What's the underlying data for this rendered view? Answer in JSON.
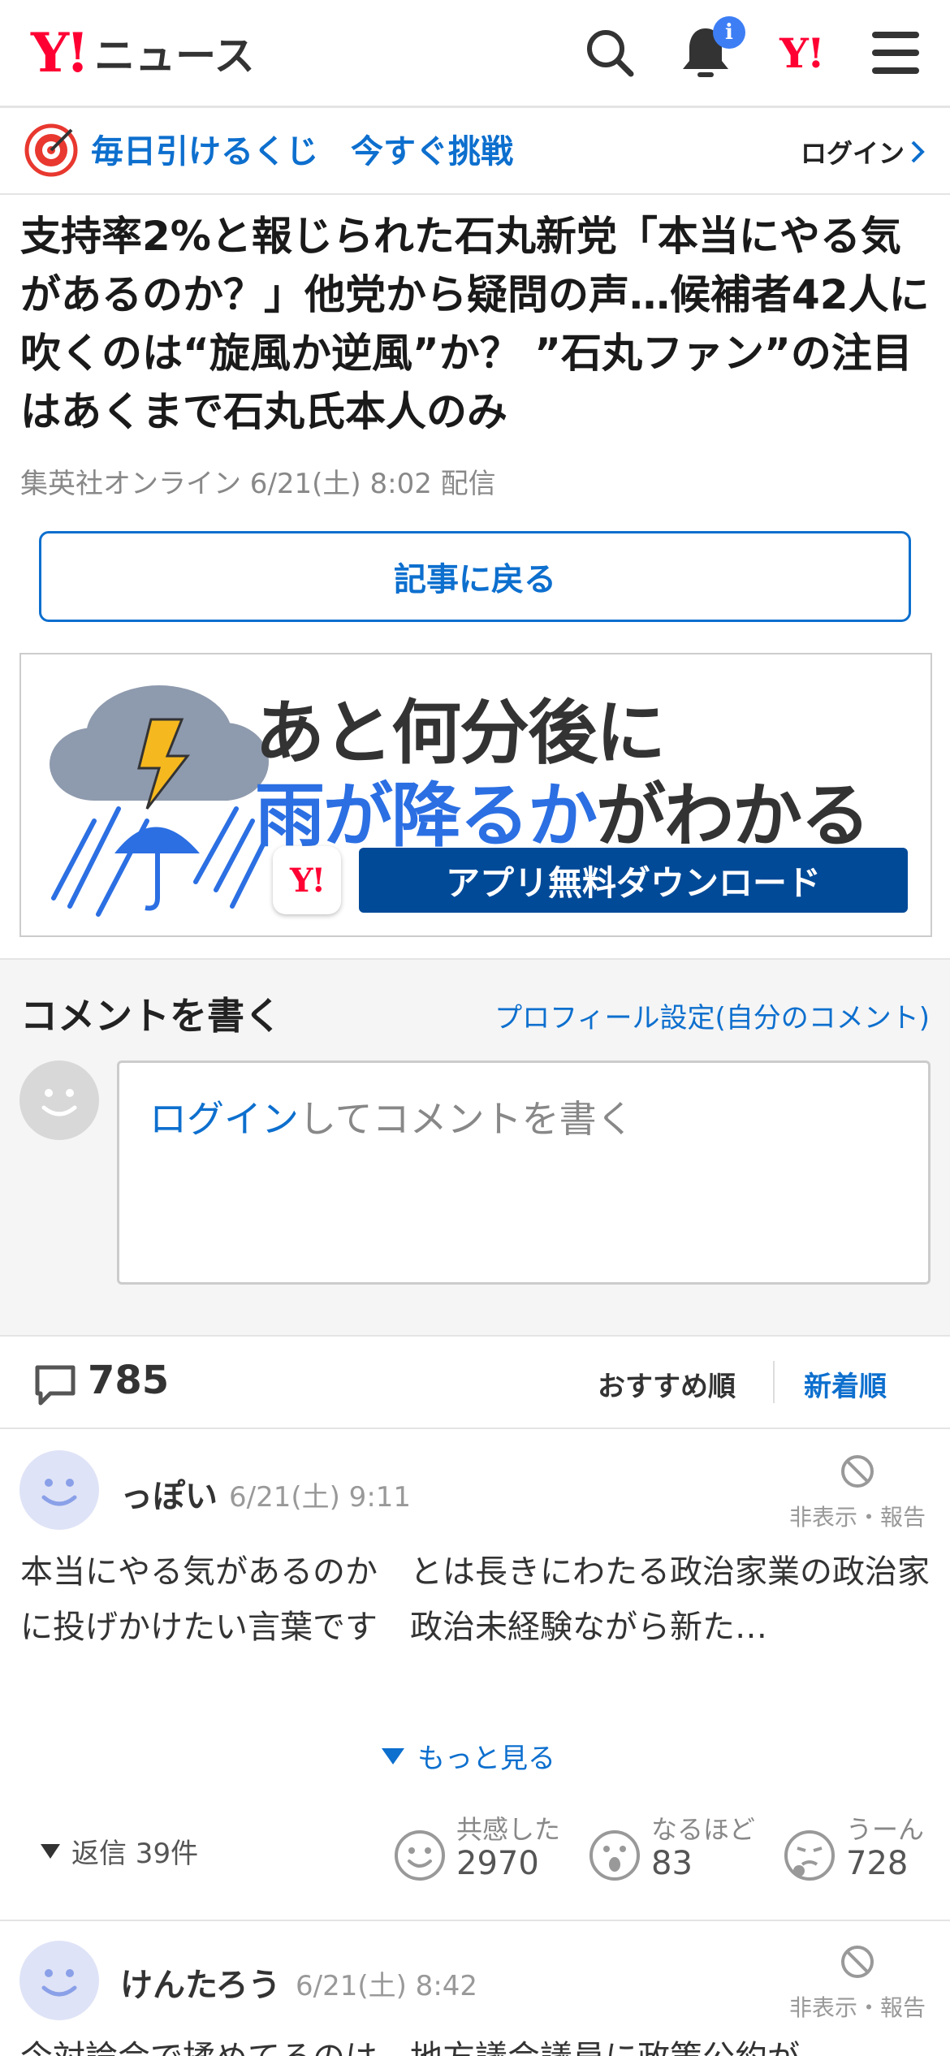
{
  "header": {
    "logo_y": "Y!",
    "logo_text": "ニュース",
    "notification_badge": "i",
    "brand_mark": "Y!",
    "icons": [
      "search-icon",
      "bell-icon",
      "yahoo-logo-icon",
      "menu-icon"
    ]
  },
  "promo": {
    "text": "毎日引けるくじ　今すぐ挑戦",
    "login": "ログイン"
  },
  "article": {
    "title": "支持率2%と報じられた石丸新党「本当にやる気があるのか？」他党から疑問の声…候補者42人に吹くのは“旋風か逆風”か？ ”石丸ファン”の注目はあくまで石丸氏本人のみ",
    "meta": "集英社オンライン 6/21(土) 8:02 配信",
    "back_button": "記事に戻る"
  },
  "ad": {
    "line1": "あと何分後に",
    "line2_blue": "雨が降るか",
    "line2_rest": "がわかる",
    "logo": "Y!",
    "download": "アプリ無料ダウンロード"
  },
  "comment_write": {
    "title": "コメントを書く",
    "profile_link": "プロフィール設定(自分のコメント)",
    "placeholder_link": "ログイン",
    "placeholder_rest": "してコメントを書く"
  },
  "comments_bar": {
    "count": "785",
    "sort_recommended": "おすすめ順",
    "sort_newest": "新着順"
  },
  "comments": [
    {
      "name": "っぽい",
      "time": "6/21(土) 9:11",
      "hide_report": "非表示・報告",
      "body": "本当にやる気があるのか　とは長きにわたる政治家業の政治家に投げかけたい言葉です　政治未経験ながら新た…",
      "more": "もっと見る",
      "replies": "返信 39件",
      "reactions": [
        {
          "label": "共感した",
          "value": "2970"
        },
        {
          "label": "なるほど",
          "value": "83"
        },
        {
          "label": "うーん",
          "value": "728"
        }
      ]
    },
    {
      "name": "けんたろう",
      "time": "6/21(土) 8:42",
      "hide_report": "非表示・報告",
      "body": "今対論会で揉めてるのは、地方議会議員に政策公約が"
    }
  ],
  "colors": {
    "link_blue": "#0d6fce",
    "yahoo_red": "#ff0033",
    "ad_dark_blue": "#004a98"
  }
}
